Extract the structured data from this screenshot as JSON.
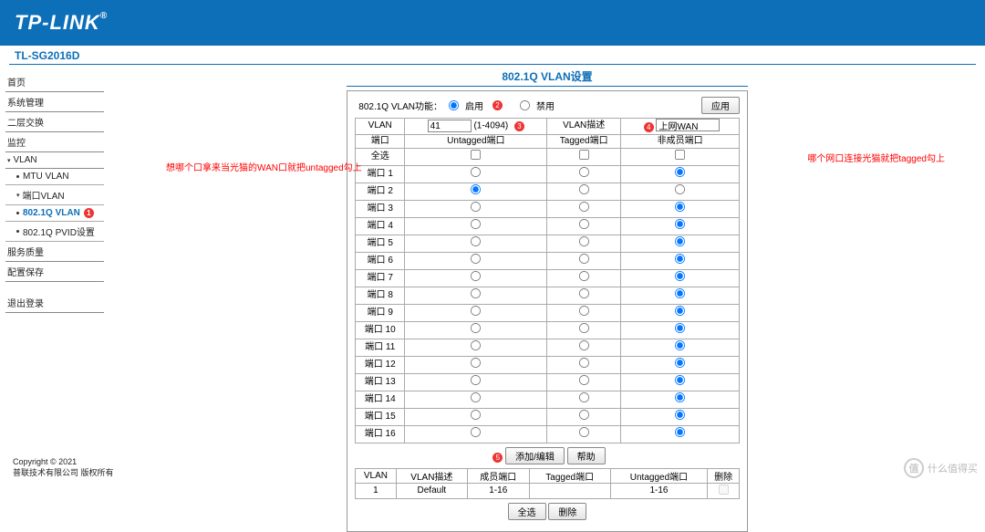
{
  "header": {
    "logo": "TP-LINK",
    "model": "TL-SG2016D"
  },
  "sidebar": {
    "items": [
      {
        "label": "首页",
        "type": "top"
      },
      {
        "label": "系统管理",
        "type": "top"
      },
      {
        "label": "二层交换",
        "type": "top"
      },
      {
        "label": "监控",
        "type": "top"
      },
      {
        "label": "VLAN",
        "type": "expand"
      },
      {
        "label": "MTU VLAN",
        "type": "sub"
      },
      {
        "label": "端口VLAN",
        "type": "expand-sub"
      },
      {
        "label": "802.1Q VLAN",
        "type": "sub-active",
        "badge": "1"
      },
      {
        "label": "802.1Q PVID设置",
        "type": "sub"
      },
      {
        "label": "服务质量",
        "type": "top"
      },
      {
        "label": "配置保存",
        "type": "top"
      },
      {
        "label": "退出登录",
        "type": "logout"
      }
    ]
  },
  "panel": {
    "title": "802.1Q VLAN设置",
    "funcLabel": "802.1Q VLAN功能：",
    "enable": "启用",
    "disable": "禁用",
    "applyBtn": "应用",
    "badge2": "2",
    "headers": {
      "vlan": "VLAN",
      "desc": "VLAN描述",
      "port": "端口",
      "untagged": "Untagged端口",
      "tagged": "Tagged端口",
      "nonmember": "非成员端口",
      "all": "全选"
    },
    "vlanIdValue": "41",
    "vlanRange": "(1-4094)",
    "badge3": "3",
    "vlanDescValue": "上网WAN",
    "badge4": "4",
    "ports": [
      {
        "name": "端口 1",
        "sel": "nonmember"
      },
      {
        "name": "端口 2",
        "sel": "untagged"
      },
      {
        "name": "端口 3",
        "sel": "nonmember"
      },
      {
        "name": "端口 4",
        "sel": "nonmember"
      },
      {
        "name": "端口 5",
        "sel": "nonmember"
      },
      {
        "name": "端口 6",
        "sel": "nonmember"
      },
      {
        "name": "端口 7",
        "sel": "nonmember"
      },
      {
        "name": "端口 8",
        "sel": "nonmember"
      },
      {
        "name": "端口 9",
        "sel": "nonmember"
      },
      {
        "name": "端口 10",
        "sel": "nonmember"
      },
      {
        "name": "端口 11",
        "sel": "nonmember"
      },
      {
        "name": "端口 12",
        "sel": "nonmember"
      },
      {
        "name": "端口 13",
        "sel": "nonmember"
      },
      {
        "name": "端口 14",
        "sel": "nonmember"
      },
      {
        "name": "端口 15",
        "sel": "nonmember"
      },
      {
        "name": "端口 16",
        "sel": "nonmember"
      }
    ],
    "addEditBtn": "添加/编辑",
    "helpBtn": "帮助",
    "badge5": "5",
    "listHeaders": {
      "vlan": "VLAN",
      "desc": "VLAN描述",
      "member": "成员端口",
      "tagged": "Tagged端口",
      "untagged": "Untagged端口",
      "del": "删除"
    },
    "listRow": {
      "vlan": "1",
      "desc": "Default",
      "member": "1-16",
      "tagged": "",
      "untagged": "1-16"
    },
    "selectAllBtn": "全选",
    "deleteBtn": "删除"
  },
  "annotations": {
    "left": "想哪个口拿来当光猫的WAN口就把untagged勾上",
    "right": "哪个网口连接光猫就把tagged勾上"
  },
  "footer": {
    "copyright": "Copyright © 2021",
    "company": "普联技术有限公司 版权所有"
  },
  "watermark": {
    "char": "值",
    "text": "什么值得买"
  }
}
